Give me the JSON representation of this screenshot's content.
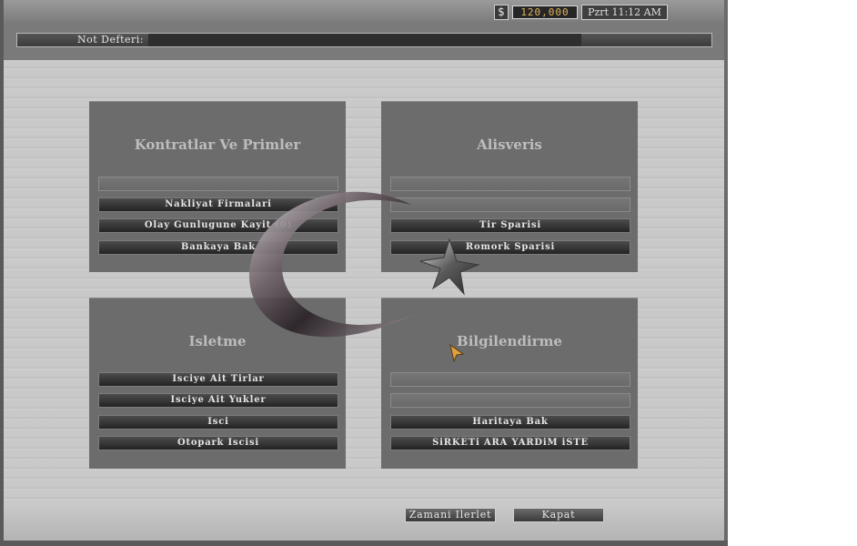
{
  "header": {
    "currency_symbol": "$",
    "money": "120,000",
    "clock": "Pzrt 11:12 AM",
    "note_label": "Not Defteri:"
  },
  "panels": {
    "contracts": {
      "title": "Kontratlar Ve Primler",
      "items": [
        "",
        "Nakliyat Firmalari",
        "Olay Gunlugune Kayit (0)",
        "Bankaya Bak"
      ]
    },
    "shopping": {
      "title": "Alisveris",
      "items": [
        "",
        "",
        "Tir Sparisi",
        "Romork Sparisi"
      ]
    },
    "business": {
      "title": "Isletme",
      "items": [
        "Isciye Ait Tirlar",
        "Isciye Ait Yukler",
        "Isci",
        "Otopark Iscisi"
      ]
    },
    "info": {
      "title": "Bilgilendirme",
      "items": [
        "",
        "",
        "Haritaya Bak",
        "SiRKETi ARA YARDiM iSTE"
      ]
    }
  },
  "footer": {
    "advance_time": "Zamani Ilerlet",
    "close": "Kapat"
  },
  "colors": {
    "money_text": "#e2b45a",
    "panel_bg": "#646464",
    "button_bg": "#2e2e2e"
  },
  "icons": [
    "dollar-icon",
    "crescent-star-emblem",
    "mouse-cursor-icon"
  ]
}
